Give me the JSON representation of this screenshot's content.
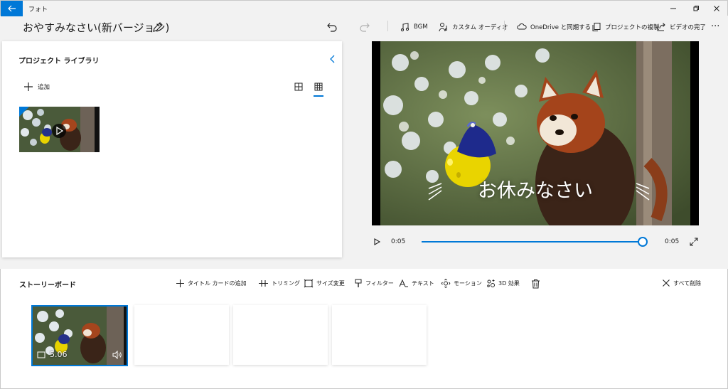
{
  "window": {
    "app_title": "フォト",
    "back_icon": "arrow-left-icon",
    "controls": [
      "minimize-icon",
      "restore-icon",
      "close-icon"
    ]
  },
  "toolbar": {
    "project_title": "おやすみなさい(新バージョン)",
    "bgm_label": "BGM",
    "custom_audio_label": "カスタム オーディオ",
    "onedrive_label": "OneDrive と同期する",
    "duplicate_label": "プロジェクトの複製",
    "finish_video_label": "ビデオの完了",
    "more_label": "···"
  },
  "library": {
    "title": "プロジェクト ライブラリ",
    "add_label": "追加"
  },
  "preview": {
    "caption": "お休みなさい",
    "current_time": "0:05",
    "total_time": "0:05",
    "progress": 1.0
  },
  "storyboard": {
    "title": "ストーリーボード",
    "actions": {
      "add_title_card": "タイトル カードの追加",
      "trim": "トリミング",
      "resize": "サイズ変更",
      "filters": "フィルター",
      "text": "テキスト",
      "motion": "モーション",
      "effects_3d": "3D 効果",
      "remove_all": "すべて削除"
    },
    "clips": [
      {
        "duration": "5.06"
      }
    ]
  },
  "colors": {
    "accent": "#0078d7",
    "background": "#f2f2f2",
    "panel": "#ffffff"
  }
}
